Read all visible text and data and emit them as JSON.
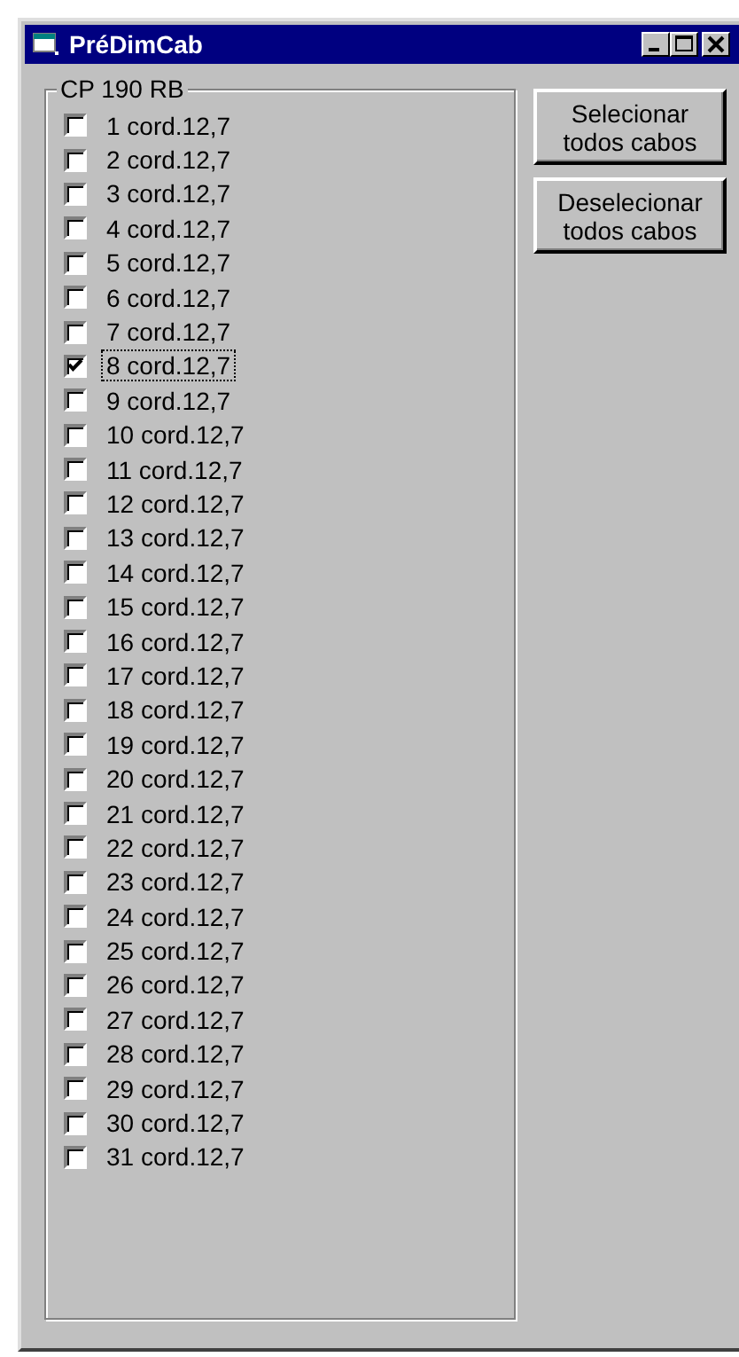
{
  "window": {
    "title": "PréDimCab"
  },
  "group": {
    "title": "CP 190 RB",
    "items": [
      {
        "label": "1 cord.12,7",
        "checked": false,
        "focused": false
      },
      {
        "label": "2 cord.12,7",
        "checked": false,
        "focused": false
      },
      {
        "label": "3 cord.12,7",
        "checked": false,
        "focused": false
      },
      {
        "label": "4 cord.12,7",
        "checked": false,
        "focused": false
      },
      {
        "label": "5 cord.12,7",
        "checked": false,
        "focused": false
      },
      {
        "label": "6 cord.12,7",
        "checked": false,
        "focused": false
      },
      {
        "label": "7 cord.12,7",
        "checked": false,
        "focused": false
      },
      {
        "label": "8 cord.12,7",
        "checked": true,
        "focused": true
      },
      {
        "label": "9 cord.12,7",
        "checked": false,
        "focused": false
      },
      {
        "label": "10 cord.12,7",
        "checked": false,
        "focused": false
      },
      {
        "label": "11 cord.12,7",
        "checked": false,
        "focused": false
      },
      {
        "label": "12 cord.12,7",
        "checked": false,
        "focused": false
      },
      {
        "label": "13 cord.12,7",
        "checked": false,
        "focused": false
      },
      {
        "label": "14 cord.12,7",
        "checked": false,
        "focused": false
      },
      {
        "label": "15 cord.12,7",
        "checked": false,
        "focused": false
      },
      {
        "label": "16 cord.12,7",
        "checked": false,
        "focused": false
      },
      {
        "label": "17 cord.12,7",
        "checked": false,
        "focused": false
      },
      {
        "label": "18 cord.12,7",
        "checked": false,
        "focused": false
      },
      {
        "label": "19 cord.12,7",
        "checked": false,
        "focused": false
      },
      {
        "label": "20 cord.12,7",
        "checked": false,
        "focused": false
      },
      {
        "label": "21 cord.12,7",
        "checked": false,
        "focused": false
      },
      {
        "label": "22 cord.12,7",
        "checked": false,
        "focused": false
      },
      {
        "label": "23 cord.12,7",
        "checked": false,
        "focused": false
      },
      {
        "label": "24 cord.12,7",
        "checked": false,
        "focused": false
      },
      {
        "label": "25 cord.12,7",
        "checked": false,
        "focused": false
      },
      {
        "label": "26 cord.12,7",
        "checked": false,
        "focused": false
      },
      {
        "label": "27 cord.12,7",
        "checked": false,
        "focused": false
      },
      {
        "label": "28 cord.12,7",
        "checked": false,
        "focused": false
      },
      {
        "label": "29 cord.12,7",
        "checked": false,
        "focused": false
      },
      {
        "label": "30 cord.12,7",
        "checked": false,
        "focused": false
      },
      {
        "label": "31 cord.12,7",
        "checked": false,
        "focused": false
      }
    ]
  },
  "buttons": [
    "Selecionar todos cabos",
    "Deselecionar todos cabos"
  ]
}
